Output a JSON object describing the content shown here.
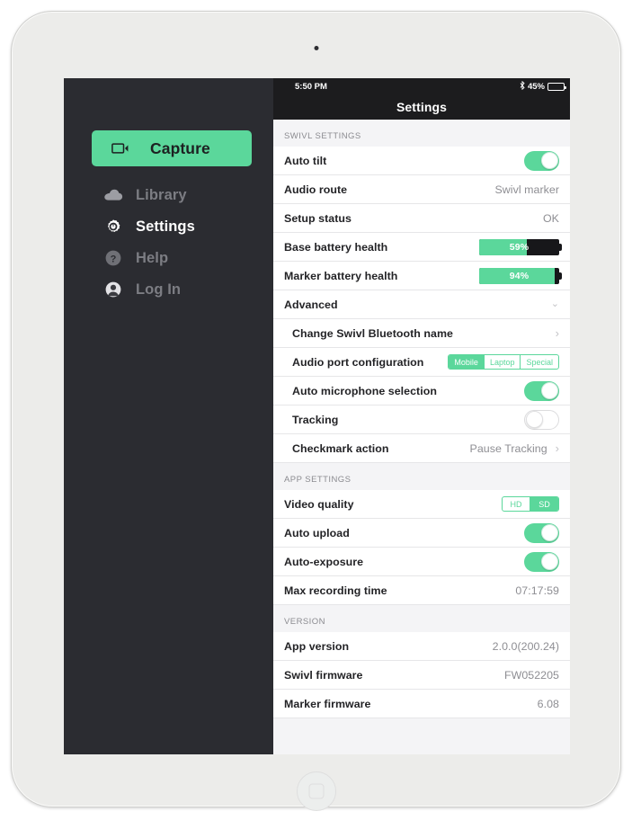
{
  "sidebar": {
    "capture": {
      "label": "Capture",
      "icon": "video-camera-icon"
    },
    "items": [
      {
        "label": "Library",
        "icon": "cloud-icon",
        "active": false
      },
      {
        "label": "Settings",
        "icon": "gear-icon",
        "active": true
      },
      {
        "label": "Help",
        "icon": "question-mark-icon",
        "active": false
      },
      {
        "label": "Log In",
        "icon": "person-icon",
        "active": false
      }
    ]
  },
  "statusbar": {
    "device": "iPad",
    "wifi_icon": "wifi-icon",
    "time": "5:50 PM",
    "bluetooth_icon": "bluetooth-icon",
    "battery_percent": "45%",
    "battery_level": 45
  },
  "navbar": {
    "title": "Settings"
  },
  "sections": [
    {
      "header": "SWIVL SETTINGS",
      "rows": [
        {
          "label": "Auto tilt",
          "control": "toggle",
          "value": "on"
        },
        {
          "label": "Audio route",
          "control": "text",
          "value": "Swivl marker"
        },
        {
          "label": "Setup status",
          "control": "text",
          "value": "OK"
        },
        {
          "label": "Base battery health",
          "control": "battery",
          "value": "59%",
          "level": 59
        },
        {
          "label": "Marker battery health",
          "control": "battery",
          "value": "94%",
          "level": 94
        },
        {
          "label": "Advanced",
          "control": "chevron-down"
        },
        {
          "label": "Change Swivl Bluetooth name",
          "control": "chevron-right",
          "sub": true
        },
        {
          "label": "Audio port configuration",
          "control": "segmented",
          "sub": true,
          "options": [
            "Mobile",
            "Laptop",
            "Special"
          ],
          "selected": "Mobile"
        },
        {
          "label": "Auto microphone selection",
          "control": "toggle",
          "value": "on",
          "sub": true
        },
        {
          "label": "Tracking",
          "control": "toggle",
          "value": "off",
          "sub": true
        },
        {
          "label": "Checkmark action",
          "control": "chevron-right",
          "value": "Pause Tracking",
          "sub": true
        }
      ]
    },
    {
      "header": "APP SETTINGS",
      "rows": [
        {
          "label": "Video quality",
          "control": "segmented",
          "options": [
            "HD",
            "SD"
          ],
          "selected": "SD"
        },
        {
          "label": "Auto upload",
          "control": "toggle",
          "value": "on"
        },
        {
          "label": "Auto-exposure",
          "control": "toggle",
          "value": "on"
        },
        {
          "label": "Max recording time",
          "control": "text",
          "value": "07:17:59"
        }
      ]
    },
    {
      "header": "VERSION",
      "rows": [
        {
          "label": "App version",
          "control": "text",
          "value": "2.0.0(200.24)"
        },
        {
          "label": "Swivl firmware",
          "control": "text",
          "value": "FW052205"
        },
        {
          "label": "Marker firmware",
          "control": "text",
          "value": "6.08"
        }
      ]
    }
  ],
  "colors": {
    "accent": "#5bd79b",
    "sidebar_bg": "#2b2c31",
    "bar_bg": "#1c1c1e",
    "group_bg": "#f4f4f6"
  }
}
